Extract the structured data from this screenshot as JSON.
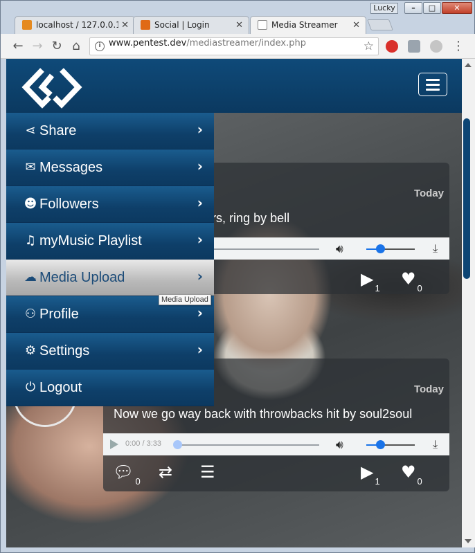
{
  "window": {
    "user_badge": "Lucky",
    "min": "–",
    "max": "□",
    "close": "✕"
  },
  "tabs": [
    {
      "title": "localhost / 127.0.0.1",
      "fav_color": "#e58a20"
    },
    {
      "title": "Social | Login",
      "fav_color": "#e06a16"
    },
    {
      "title": "Media Streamer",
      "fav_color": "#ffffff"
    }
  ],
  "toolbar": {
    "url_host": "www.pentest.dev",
    "url_path": "/mediastreamer/index.php",
    "back": "←",
    "forward": "→",
    "reload": "↻",
    "home": "⌂",
    "star": "☆",
    "more": "⋮"
  },
  "app": {
    "menu_items": [
      {
        "icon": "⋖",
        "label": "Share"
      },
      {
        "icon": "✉",
        "label": "Messages"
      },
      {
        "icon": "☻",
        "label": "Followers"
      },
      {
        "icon": "♫",
        "label": "myMusic Playlist"
      },
      {
        "icon": "☁",
        "label": "Media Upload"
      },
      {
        "icon": "⚇",
        "label": "Profile"
      },
      {
        "icon": "⚙",
        "label": "Settings"
      },
      {
        "icon": "⏻",
        "label": "Logout"
      }
    ],
    "chevron": "›",
    "tooltip": "Media Upload",
    "posts": [
      {
        "time": "Today",
        "title": "cks by blood sisters, ring by bell",
        "likes_play": "1",
        "likes_heart": "0"
      },
      {
        "time": "Today",
        "title": "Now we go way back with throwbacks hit by soul2soul",
        "player_time": "0:00 / 3:33",
        "comments": "0",
        "likes_play": "1",
        "likes_heart": "0"
      }
    ]
  },
  "colors": {
    "nav_blue": "#0e3f69",
    "hover_gray": "#b9b9b9",
    "scroll_thumb": "#0d4574"
  }
}
